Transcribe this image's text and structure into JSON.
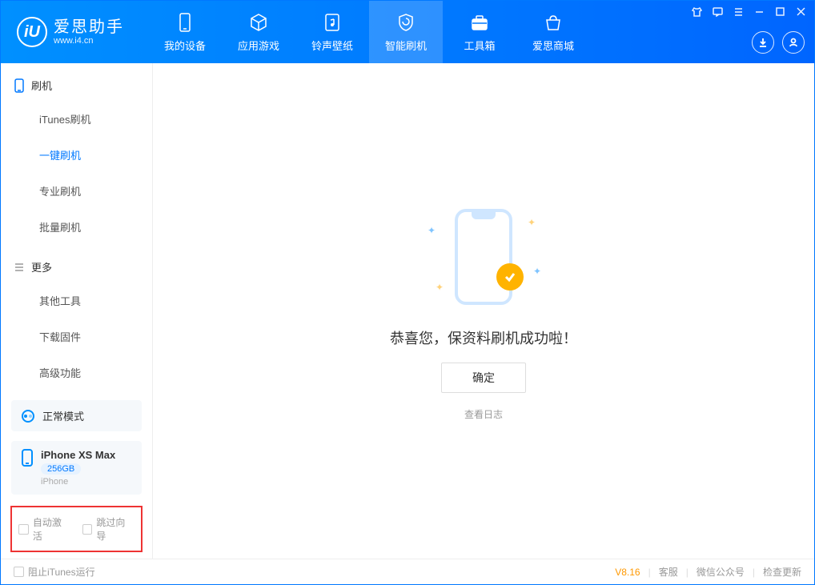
{
  "app": {
    "name_cn": "爱思助手",
    "name_en": "www.i4.cn",
    "logo_letter": "iU"
  },
  "nav": [
    {
      "label": "我的设备",
      "icon": "device"
    },
    {
      "label": "应用游戏",
      "icon": "cube"
    },
    {
      "label": "铃声壁纸",
      "icon": "music"
    },
    {
      "label": "智能刷机",
      "icon": "shield",
      "active": true
    },
    {
      "label": "工具箱",
      "icon": "toolbox"
    },
    {
      "label": "爱思商城",
      "icon": "store"
    }
  ],
  "sidebar": {
    "group1": {
      "title": "刷机",
      "items": [
        "iTunes刷机",
        "一键刷机",
        "专业刷机",
        "批量刷机"
      ],
      "active_index": 1
    },
    "group2": {
      "title": "更多",
      "items": [
        "其他工具",
        "下载固件",
        "高级功能"
      ]
    }
  },
  "mode_box": {
    "label": "正常模式"
  },
  "device": {
    "name": "iPhone XS Max",
    "capacity": "256GB",
    "type": "iPhone"
  },
  "highlight": {
    "opt1": "自动激活",
    "opt2": "跳过向导"
  },
  "main": {
    "message": "恭喜您，保资料刷机成功啦！",
    "ok": "确定",
    "log": "查看日志"
  },
  "footer": {
    "block_itunes": "阻止iTunes运行",
    "version": "V8.16",
    "link1": "客服",
    "link2": "微信公众号",
    "link3": "检查更新"
  }
}
